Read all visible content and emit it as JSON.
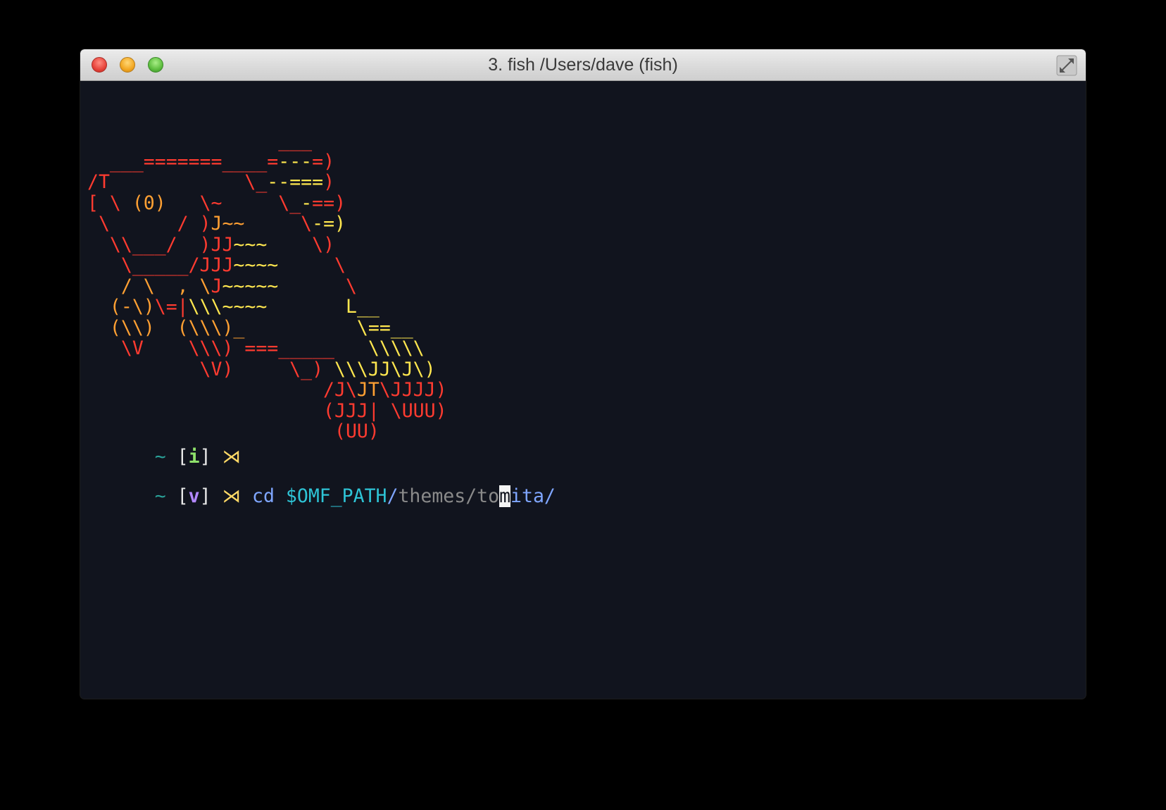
{
  "window": {
    "title": "3. fish  /Users/dave (fish)",
    "buttons": [
      "close",
      "minimize",
      "zoom",
      "fullscreen"
    ]
  },
  "colors": {
    "red": "#ff3b30",
    "orange": "#ffa033",
    "yellow": "#ffe74f",
    "prompt_tilde": "#2aa198",
    "mode_insert": "#8ee06b",
    "mode_visual": "#b388ff",
    "arrow": "#ffd966",
    "cmd_blue": "#7fa6ff",
    "cmd_cyan": "#2ec4d6",
    "cmd_gray": "#8a8a8a",
    "background": "#11141e"
  },
  "art": [
    [
      [
        "                 ___",
        "r"
      ]
    ],
    [
      [
        "  ___",
        "r"
      ],
      [
        "=======",
        "r"
      ],
      [
        "____",
        "r"
      ],
      [
        "=",
        "r"
      ],
      [
        "---",
        "y"
      ],
      [
        "=)",
        "r"
      ]
    ],
    [
      [
        "/T",
        "r"
      ],
      [
        "            ",
        "r"
      ],
      [
        "\\_",
        "r"
      ],
      [
        "--",
        "y"
      ],
      [
        "===",
        "y"
      ],
      [
        ")",
        "r"
      ]
    ],
    [
      [
        "[ \\ ",
        "r"
      ],
      [
        "(0)",
        "o"
      ],
      [
        "   \\~",
        "r"
      ],
      [
        "     ",
        "r"
      ],
      [
        "\\_",
        "r"
      ],
      [
        "-",
        "y"
      ],
      [
        "==)",
        "r"
      ]
    ],
    [
      [
        " \\      / )",
        "r"
      ],
      [
        "J~~",
        "o"
      ],
      [
        "     ",
        "r"
      ],
      [
        "\\",
        "r"
      ],
      [
        "-=)",
        "y"
      ]
    ],
    [
      [
        "  \\\\___/  )JJ",
        "r"
      ],
      [
        "~~~",
        "y"
      ],
      [
        "    \\)",
        "r"
      ]
    ],
    [
      [
        "   \\_____/JJJ",
        "r"
      ],
      [
        "~~~~",
        "y"
      ],
      [
        "     \\",
        "r"
      ]
    ],
    [
      [
        "   / \\  , \\",
        "o"
      ],
      [
        "J",
        "r"
      ],
      [
        "~~~~~",
        "y"
      ],
      [
        "      \\",
        "r"
      ]
    ],
    [
      [
        "  (-\\)",
        "o"
      ],
      [
        "\\=|",
        "r"
      ],
      [
        "\\\\\\",
        "y"
      ],
      [
        "~~~~",
        "y"
      ],
      [
        "       L__",
        "y"
      ]
    ],
    [
      [
        "  (\\\\)  (\\\\\\)_",
        "o"
      ],
      [
        "          \\==__",
        "y"
      ]
    ],
    [
      [
        "   \\V    \\\\\\) ",
        "r"
      ],
      [
        "===_____",
        "r"
      ],
      [
        "   \\\\\\\\\\",
        "y"
      ]
    ],
    [
      [
        "          \\V)     \\_) ",
        "r"
      ],
      [
        "\\\\\\JJ\\J\\)",
        "y"
      ]
    ],
    [
      [
        "                     /J\\",
        "r"
      ],
      [
        "JT",
        "o"
      ],
      [
        "\\JJJJ)",
        "r"
      ]
    ],
    [
      [
        "                     (JJJ| \\UUU)",
        "r"
      ]
    ],
    [
      [
        "                      (UU)",
        "r"
      ]
    ]
  ],
  "prompt1": {
    "tilde": "~",
    "mode": "i",
    "arrow": "⋊"
  },
  "prompt2": {
    "tilde": "~",
    "mode": "v",
    "arrow": "⋊",
    "cmd": "cd",
    "var": "$OMF_PATH",
    "path_a": "/",
    "path_gray": "themes/to",
    "cursor_char": "m",
    "path_b": "ita/"
  }
}
